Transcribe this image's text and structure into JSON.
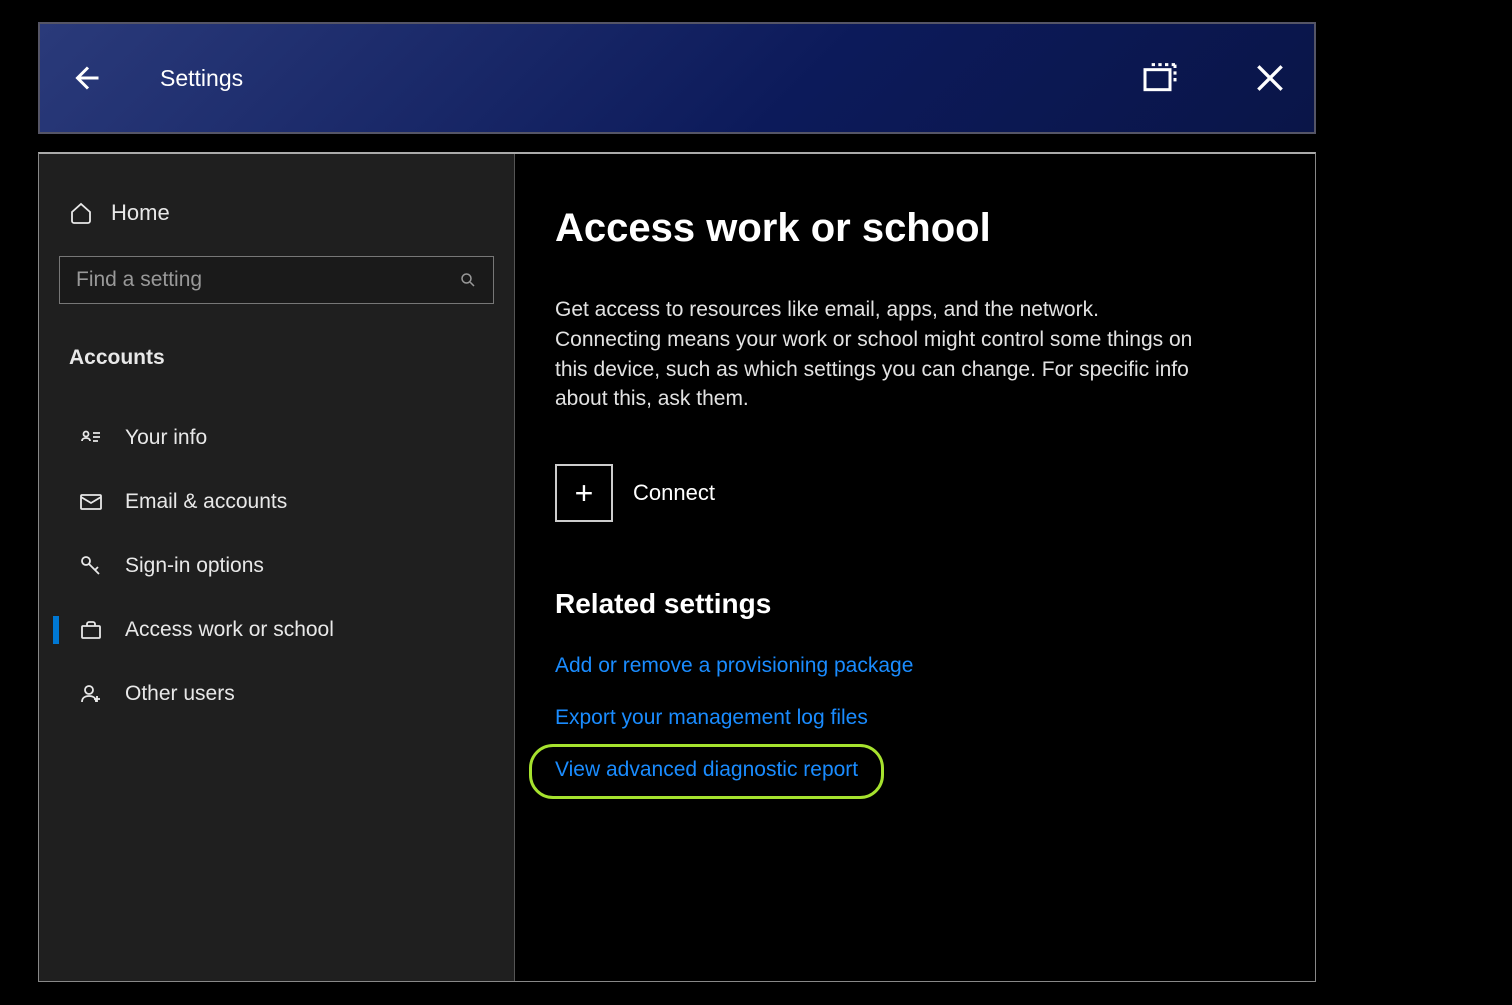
{
  "titlebar": {
    "title": "Settings"
  },
  "sidebar": {
    "home_label": "Home",
    "search_placeholder": "Find a setting",
    "category_label": "Accounts",
    "items": [
      {
        "label": "Your info"
      },
      {
        "label": "Email & accounts"
      },
      {
        "label": "Sign-in options"
      },
      {
        "label": "Access work or school"
      },
      {
        "label": "Other users"
      }
    ]
  },
  "main": {
    "heading": "Access work or school",
    "description": "Get access to resources like email, apps, and the network. Connecting means your work or school might control some things on this device, such as which settings you can change. For specific info about this, ask them.",
    "connect_label": "Connect",
    "related_heading": "Related settings",
    "links": [
      {
        "label": "Add or remove a provisioning package"
      },
      {
        "label": "Export your management log files"
      },
      {
        "label": "View advanced diagnostic report"
      }
    ]
  }
}
